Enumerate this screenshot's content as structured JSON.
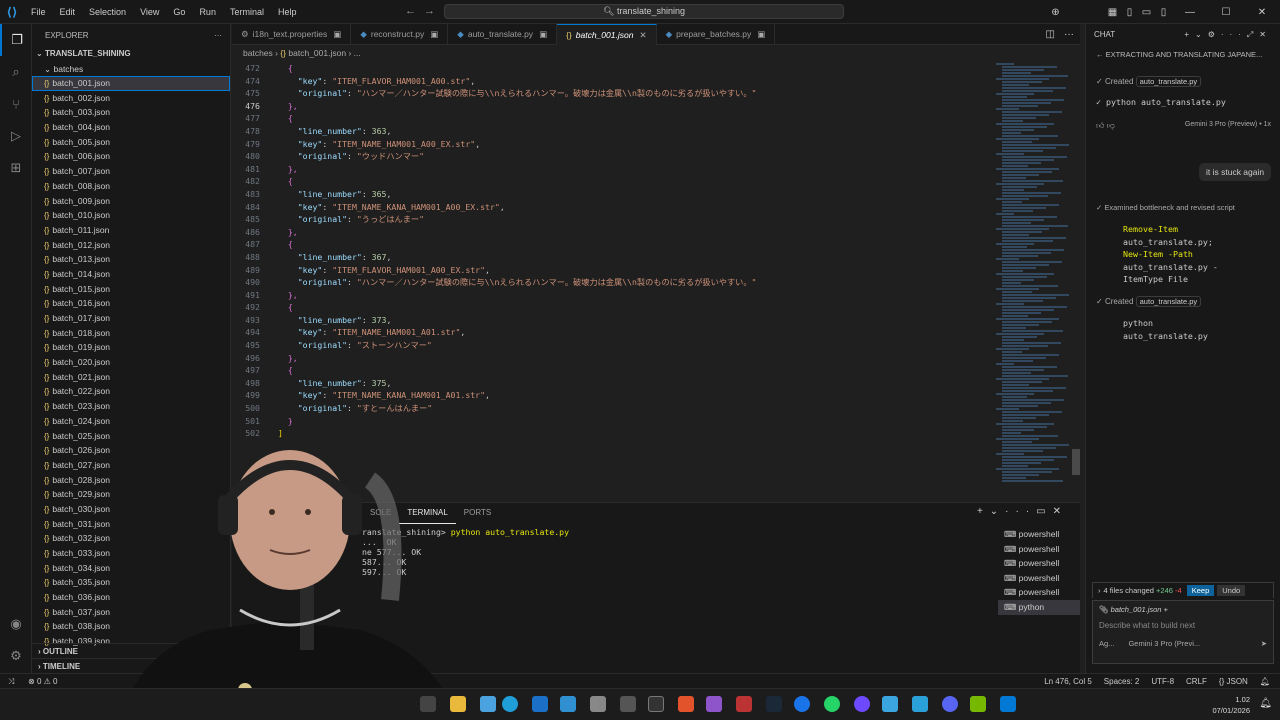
{
  "window": {
    "search": "translate_shining"
  },
  "menu": [
    "File",
    "Edit",
    "Selection",
    "View",
    "Go",
    "Run",
    "Terminal",
    "Help"
  ],
  "explorer": {
    "title": "EXPLORER",
    "root": "TRANSLATE_SHINING",
    "folder": "batches",
    "files": [
      "batch_001.json",
      "batch_002.json",
      "batch_003.json",
      "batch_004.json",
      "batch_005.json",
      "batch_006.json",
      "batch_007.json",
      "batch_008.json",
      "batch_009.json",
      "batch_010.json",
      "batch_011.json",
      "batch_012.json",
      "batch_013.json",
      "batch_014.json",
      "batch_015.json",
      "batch_016.json",
      "batch_017.json",
      "batch_018.json",
      "batch_019.json",
      "batch_020.json",
      "batch_021.json",
      "batch_022.json",
      "batch_023.json",
      "batch_024.json",
      "batch_025.json",
      "batch_026.json",
      "batch_027.json",
      "batch_028.json",
      "batch_029.json",
      "batch_030.json",
      "batch_031.json",
      "batch_032.json",
      "batch_033.json",
      "batch_034.json",
      "batch_035.json",
      "batch_036.json",
      "batch_037.json",
      "batch_038.json",
      "batch_039.json"
    ],
    "outline": "OUTLINE",
    "timeline": "TIMELINE"
  },
  "tabs": [
    {
      "label": "i18n_text.properties",
      "icon": "⚙"
    },
    {
      "label": "reconstruct.py",
      "icon": "◆"
    },
    {
      "label": "auto_translate.py",
      "icon": "◆"
    },
    {
      "label": "batch_001.json",
      "icon": "{}",
      "active": true
    },
    {
      "label": "prepare_batches.py",
      "icon": "◆"
    }
  ],
  "breadcrumb": {
    "folder": "batches",
    "file": "batch_001.json",
    "more": "..."
  },
  "code": [
    {
      "n": "472",
      "t": "  {",
      "c": "b1"
    },
    {
      "n": "474",
      "t": "    \"key\": \"ITEM_FLAVOR_HAM001_A00.str\","
    },
    {
      "n": "475",
      "t": "    \"original\": \"ハンマー／ハンター試験の際に与\\\\nえられるハンマー。破壊力は金属\\\\n製のものに劣るが扱いやすい。\""
    },
    {
      "n": "476",
      "t": "  },",
      "c": "b1",
      "cur": true
    },
    {
      "n": "477",
      "t": "  {",
      "c": "b1"
    },
    {
      "n": "478",
      "t": "    \"line_number\": 363,"
    },
    {
      "n": "479",
      "t": "    \"key\": \"ITEM_NAME_HAM001_A00_EX.str\","
    },
    {
      "n": "480",
      "t": "    \"original\": \"ウッドハンマー\""
    },
    {
      "n": "481",
      "t": "  },",
      "c": "b1"
    },
    {
      "n": "482",
      "t": "  {",
      "c": "b1"
    },
    {
      "n": "483",
      "t": "    \"line_number\": 365,"
    },
    {
      "n": "484",
      "t": "    \"key\": \"ITEM_NAME_KANA_HAM001_A00_EX.str\","
    },
    {
      "n": "485",
      "t": "    \"original\": \"うっどはんまー\""
    },
    {
      "n": "486",
      "t": "  },",
      "c": "b1"
    },
    {
      "n": "487",
      "t": "  {",
      "c": "b1"
    },
    {
      "n": "488",
      "t": "    \"line_number\": 367,"
    },
    {
      "n": "489",
      "t": "    \"key\": \"ITEM_FLAVOR_HAM001_A00_EX.str\","
    },
    {
      "n": "490",
      "t": "    \"original\": \"ハンマー／ハンター試験の際に与\\\\nえられるハンマー。破壊力は金属\\\\n製のものに劣るが扱いやすい。\""
    },
    {
      "n": "491",
      "t": "  },",
      "c": "b1"
    },
    {
      "n": "492",
      "t": "  {",
      "c": "b1"
    },
    {
      "n": "493",
      "t": "    \"line_number\": 373,"
    },
    {
      "n": "494",
      "t": "    \"key\": \"ITEM_NAME_HAM001_A01.str\","
    },
    {
      "n": "495",
      "t": "    \"original\": \"ストーンハンマー\""
    },
    {
      "n": "496",
      "t": "  },",
      "c": "b1"
    },
    {
      "n": "497",
      "t": "  {",
      "c": "b1"
    },
    {
      "n": "498",
      "t": "    \"line_number\": 375,"
    },
    {
      "n": "499",
      "t": "    \"key\": \"ITEM_NAME_KANA_HAM001_A01.str\","
    },
    {
      "n": "500",
      "t": "    \"original\": \"すとーんはんまー\""
    },
    {
      "n": "501",
      "t": "  }",
      "c": "b1"
    },
    {
      "n": "502",
      "t": "]",
      "c": "b0"
    }
  ],
  "panel": {
    "tabs": [
      "SOLE",
      "TERMINAL",
      "PORTS"
    ],
    "terminal": [
      {
        "t": "ranslate_shining> python auto_translate.py",
        "cmd": true
      },
      {
        "t": "...  OK"
      },
      {
        "t": "ne 577... OK"
      },
      {
        "t": "587... OK"
      },
      {
        "t": "597... OK"
      }
    ],
    "shells": [
      "powershell",
      "powershell",
      "powershell",
      "powershell",
      "powershell",
      "python"
    ]
  },
  "chat": {
    "title": "CHAT",
    "subtitle": "EXTRACTING AND TRANSLATING JAPANE...",
    "created1": "Created",
    "file1": "auto_translate.py",
    "cmd1": "python auto_translate.py",
    "model": "Gemini 3 Pro (Preview) • 1x",
    "user_msg": "it is stuck again",
    "examined": "Examined bottleneck and revised script",
    "code_lines": [
      "Remove-Item",
      "auto_translate.py;",
      "New-Item -Path",
      "auto_translate.py -",
      "ItemType File"
    ],
    "created2": "Created",
    "file2": "auto_translate.py",
    "cmd2a": "python",
    "cmd2b": "auto_translate.py",
    "files_changed": "4 files changed",
    "plus": "+246",
    "minus": "-4",
    "keep": "Keep",
    "undo": "Undo",
    "attached": "batch_001.json",
    "placeholder": "Describe what to build next",
    "agent": "Ag...",
    "model2": "Gemini 3 Pro (Previ..."
  },
  "status": {
    "errors": "0",
    "warnings": "0",
    "position": "Ln 476, Col 5",
    "spaces": "Spaces: 2",
    "encoding": "UTF-8",
    "eol": "CRLF",
    "lang": "JSON"
  },
  "clock": {
    "time": "1.02",
    "date": "07/01/2026"
  }
}
